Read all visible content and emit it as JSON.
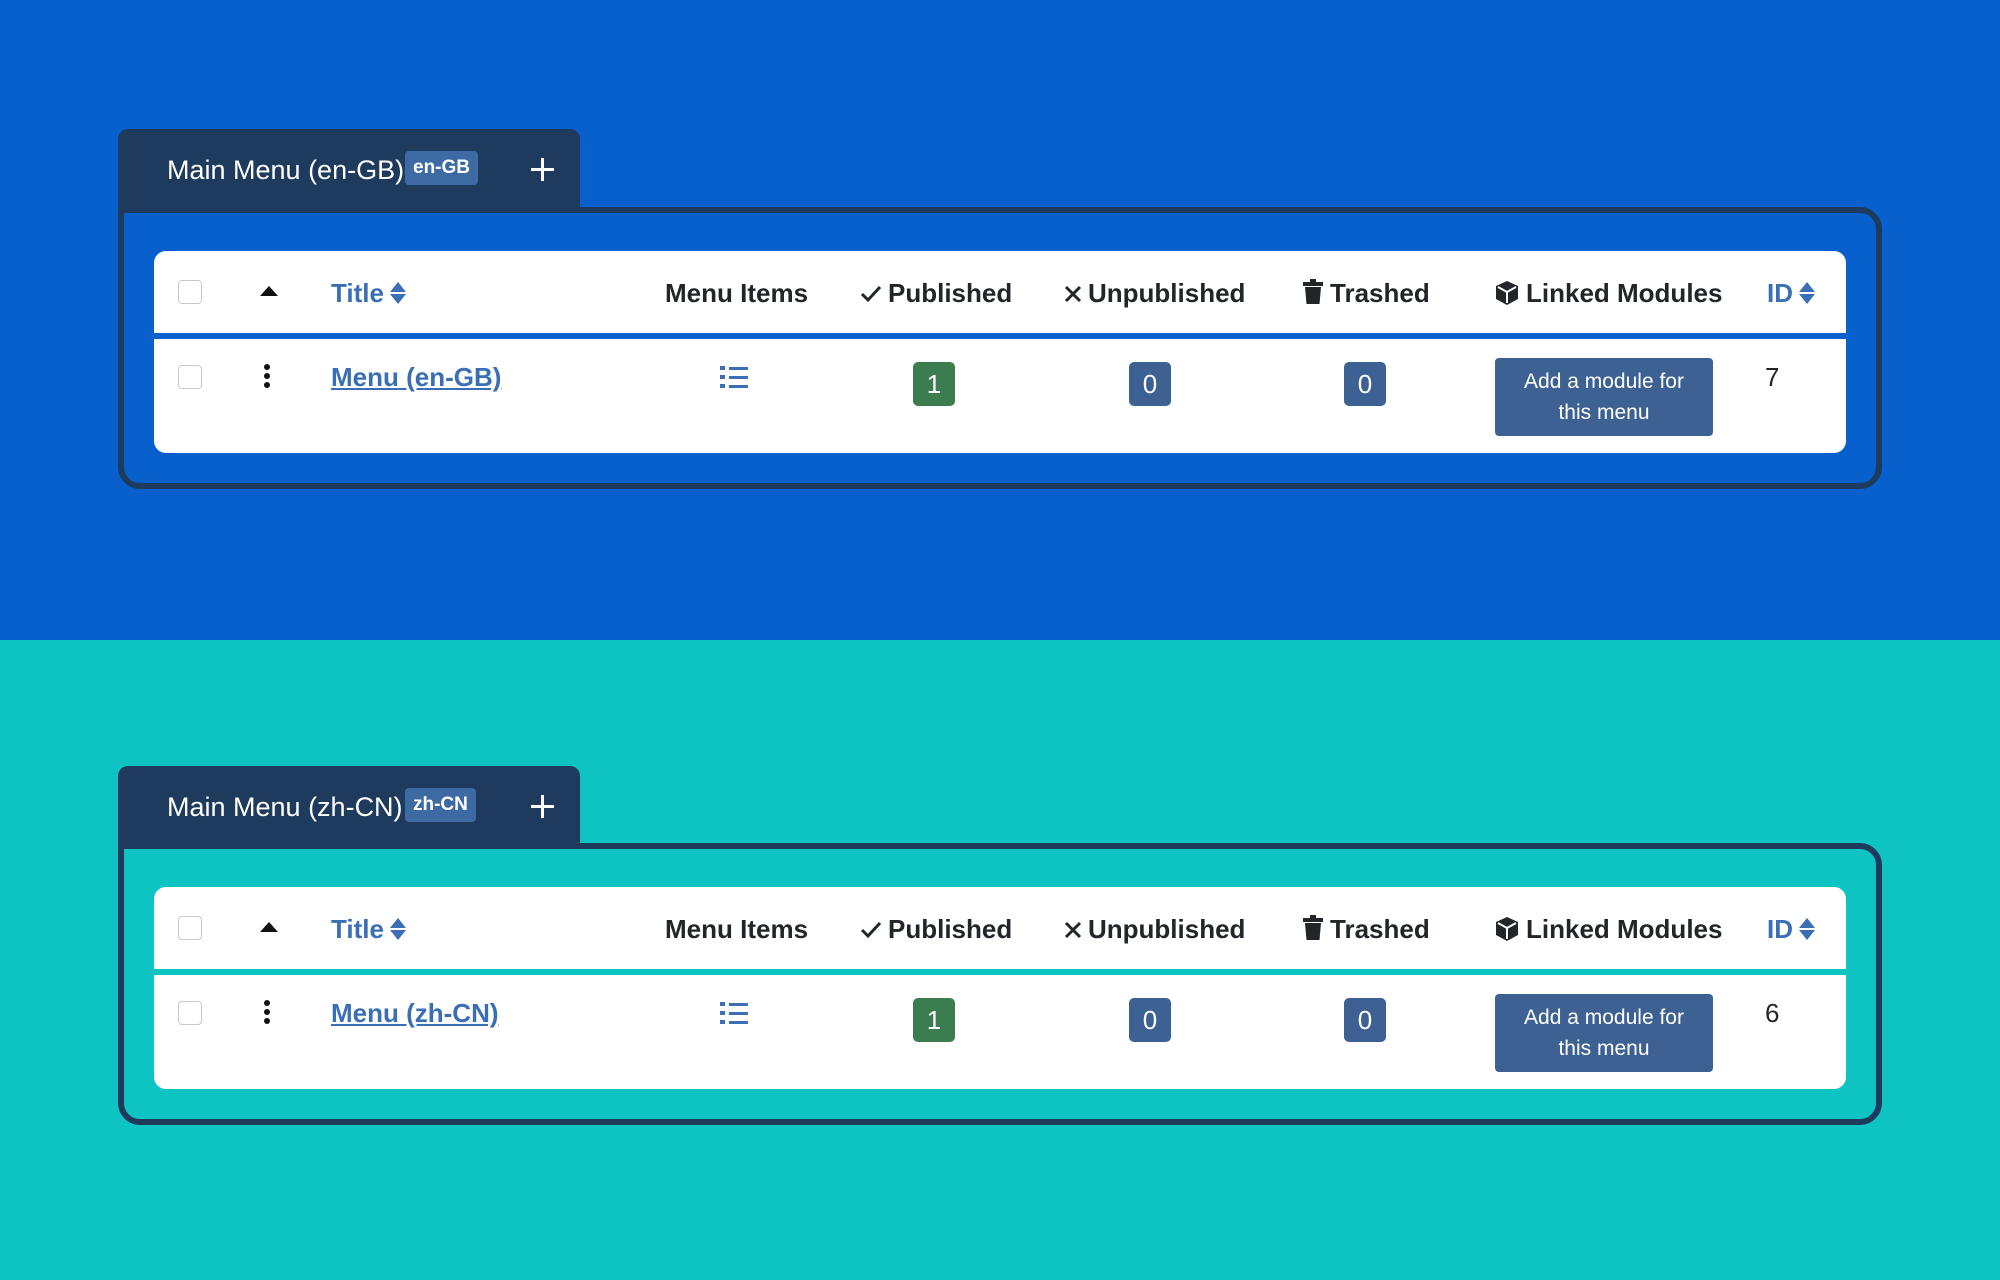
{
  "panels": [
    {
      "background": "#0760cb",
      "header": {
        "title": "Main Menu (en-GB)",
        "badge": "en-GB",
        "add_icon": "plus-icon"
      },
      "table": {
        "columns": {
          "title": "Title",
          "menu_items": "Menu Items",
          "published": "Published",
          "unpublished": "Unpublished",
          "trashed": "Trashed",
          "linked_modules": "Linked Modules",
          "id": "ID"
        },
        "row": {
          "title": "Menu (en-GB)",
          "published": "1",
          "unpublished": "0",
          "trashed": "0",
          "add_module": "Add a module for this menu",
          "id": "7"
        }
      }
    },
    {
      "background": "#0dc4c2",
      "header": {
        "title": "Main Menu (zh-CN)",
        "badge": "zh-CN",
        "add_icon": "plus-icon"
      },
      "table": {
        "columns": {
          "title": "Title",
          "menu_items": "Menu Items",
          "published": "Published",
          "unpublished": "Unpublished",
          "trashed": "Trashed",
          "linked_modules": "Linked Modules",
          "id": "ID"
        },
        "row": {
          "title": "Menu (zh-CN)",
          "published": "1",
          "unpublished": "0",
          "trashed": "0",
          "add_module": "Add a module for this menu",
          "id": "6"
        }
      }
    }
  ],
  "colors": {
    "header_dark": "#1e3a5c",
    "link": "#3a6fb5",
    "published_badge": "#3b7d4f",
    "count_badge": "#3d6192",
    "add_module_button": "#3d6192"
  }
}
